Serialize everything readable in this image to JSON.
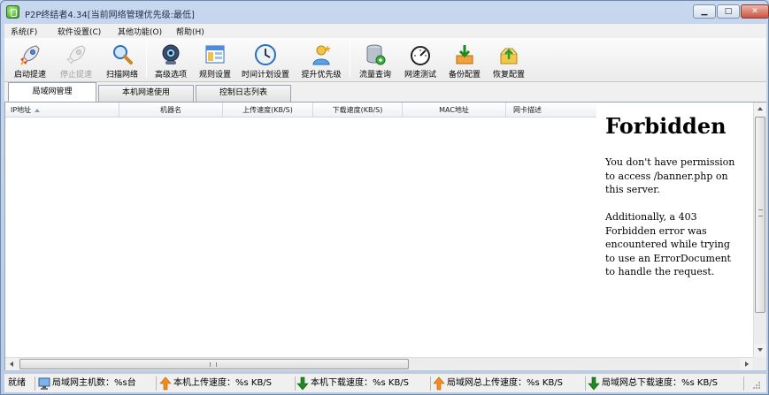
{
  "window": {
    "title": "P2P终结者4.34[当前网络管理优先级:最低]",
    "minimize_glyph": "▁",
    "maximize_glyph": "□",
    "close_glyph": "✕"
  },
  "menu": {
    "items": [
      {
        "label": "系统(F)"
      },
      {
        "label": "软件设置(C)"
      },
      {
        "label": "其他功能(O)"
      },
      {
        "label": "帮助(H)"
      }
    ]
  },
  "toolbar": {
    "buttons": [
      {
        "label": "启动提速",
        "icon": "rocket-icon",
        "enabled": true
      },
      {
        "label": "停止提速",
        "icon": "rocket-disabled-icon",
        "enabled": false
      },
      {
        "label": "扫描网络",
        "icon": "magnifier-icon",
        "enabled": true
      },
      {
        "label": "高级选项",
        "icon": "webcam-icon",
        "enabled": true
      },
      {
        "label": "规则设置",
        "icon": "rules-window-icon",
        "enabled": true
      },
      {
        "label": "时间计划设置",
        "icon": "clock-icon",
        "enabled": true
      },
      {
        "label": "提升优先级",
        "icon": "user-star-icon",
        "enabled": true
      },
      {
        "label": "流量查询",
        "icon": "database-icon",
        "enabled": true
      },
      {
        "label": "网速测试",
        "icon": "speedometer-icon",
        "enabled": true
      },
      {
        "label": "备份配置",
        "icon": "download-box-icon",
        "enabled": true
      },
      {
        "label": "恢复配置",
        "icon": "restore-box-icon",
        "enabled": true
      }
    ]
  },
  "tabs": [
    {
      "label": "局域网管理",
      "active": true
    },
    {
      "label": "本机网速使用",
      "active": false
    },
    {
      "label": "控制日志列表",
      "active": false
    }
  ],
  "list": {
    "columns": [
      "IP地址",
      "机器名",
      "上传速度(KB/S)",
      "下载速度(KB/S)",
      "MAC地址",
      "网卡描述"
    ],
    "rows": []
  },
  "banner": {
    "heading": "Forbidden",
    "paragraph1": "You don't have permission to access /banner.php on this server.",
    "paragraph2": "Additionally, a 403 Forbidden error was encountered while trying to use an ErrorDocument to handle the request."
  },
  "statusbar": {
    "ready": "就绪",
    "host_count": "局域网主机数：%s台",
    "local_upload": "本机上传速度：%s KB/S",
    "local_download": "本机下载速度：%s KB/S",
    "lan_upload": "局域网总上传速度：%s KB/S",
    "lan_download": "局域网总下载速度：%s KB/S"
  },
  "colors": {
    "up_arrow": "#f28c1a",
    "down_arrow": "#1f8a1f",
    "accent": "#6f89ad"
  }
}
